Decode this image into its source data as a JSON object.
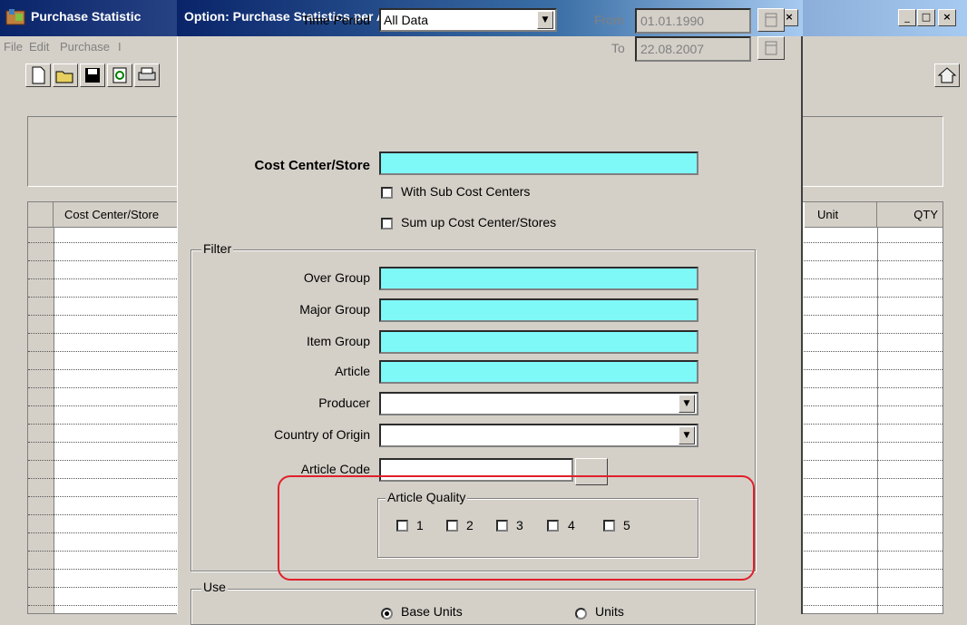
{
  "main_window": {
    "title": "Purchase Statistic",
    "menu": [
      "File",
      "Edit",
      "Purchase",
      "I"
    ],
    "grid_headers": {
      "col1": "Cost Center/Store",
      "unit": "Unit",
      "qty": "QTY"
    },
    "buttons": {
      "minimize": "_",
      "maximize": "□",
      "close": "×"
    }
  },
  "dialog": {
    "title": "Option: Purchase Statistics per Article",
    "close": "×",
    "time_period": {
      "label": "Time Period",
      "value": "All Data"
    },
    "from": {
      "label": "From",
      "value": "01.01.1990"
    },
    "to": {
      "label": "To",
      "value": "22.08.2007"
    },
    "cost_center": {
      "label": "Cost Center/Store",
      "value": ""
    },
    "with_sub": {
      "label": "With Sub Cost Centers",
      "checked": false
    },
    "sum_up": {
      "label": "Sum up Cost Center/Stores",
      "checked": false
    },
    "filter": {
      "caption": "Filter",
      "over_group": {
        "label": "Over Group",
        "value": ""
      },
      "major_group": {
        "label": "Major Group",
        "value": ""
      },
      "item_group": {
        "label": "Item Group",
        "value": ""
      },
      "article": {
        "label": "Article",
        "value": ""
      },
      "producer": {
        "label": "Producer",
        "value": ""
      },
      "country": {
        "label": "Country of Origin",
        "value": ""
      },
      "article_code": {
        "label": "Article Code",
        "value": ""
      }
    },
    "article_quality": {
      "caption": "Article Quality",
      "options": [
        "1",
        "2",
        "3",
        "4",
        "5"
      ]
    },
    "use": {
      "caption": "Use",
      "base_units": {
        "label": "Base Units",
        "selected": true
      },
      "units": {
        "label": "Units",
        "selected": false
      }
    }
  },
  "colors": {
    "highlight": "#e0202a",
    "required_field": "#7ff8f8",
    "title_bar": "#0a246a"
  }
}
